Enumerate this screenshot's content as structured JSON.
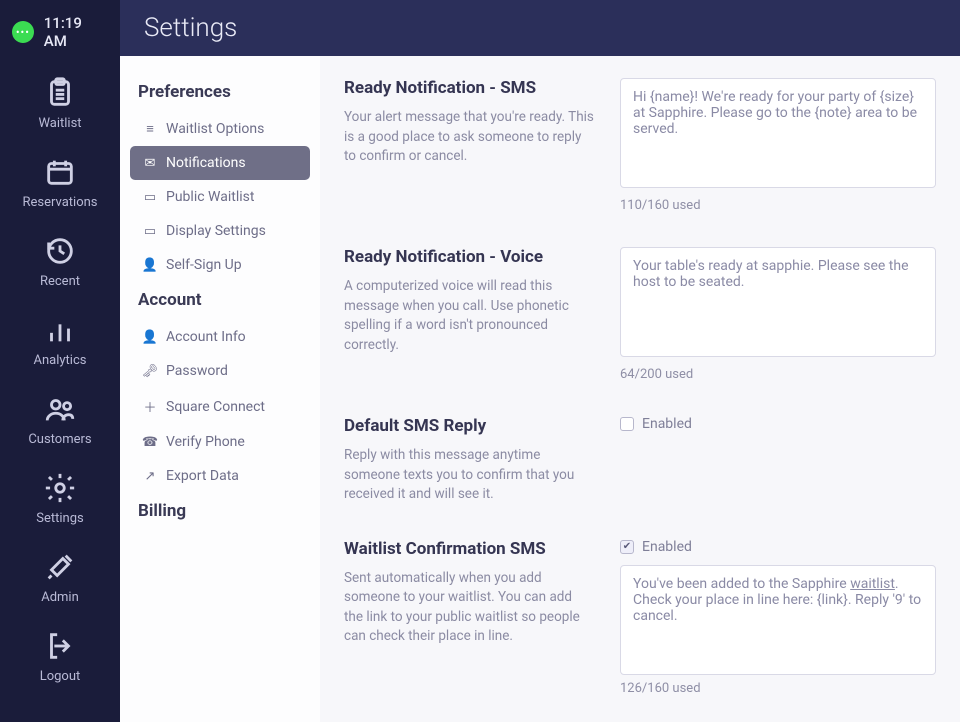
{
  "header": {
    "title": "Settings",
    "clock": "11:19 AM"
  },
  "nav": {
    "items": [
      {
        "label": "Waitlist"
      },
      {
        "label": "Reservations"
      },
      {
        "label": "Recent"
      },
      {
        "label": "Analytics"
      },
      {
        "label": "Customers"
      },
      {
        "label": "Settings"
      },
      {
        "label": "Admin"
      },
      {
        "label": "Logout"
      }
    ]
  },
  "settingsNav": {
    "groups": [
      {
        "title": "Preferences",
        "items": [
          {
            "label": "Waitlist Options",
            "icon": "≡"
          },
          {
            "label": "Notifications",
            "icon": "✉",
            "active": true
          },
          {
            "label": "Public Waitlist",
            "icon": "▭"
          },
          {
            "label": "Display Settings",
            "icon": "▭"
          },
          {
            "label": "Self-Sign Up",
            "icon": "👤"
          }
        ]
      },
      {
        "title": "Account",
        "items": [
          {
            "label": "Account Info",
            "icon": "👤"
          },
          {
            "label": "Password",
            "icon": "🗝"
          },
          {
            "label": "Square Connect",
            "icon": "＋"
          },
          {
            "label": "Verify Phone",
            "icon": "☎"
          },
          {
            "label": "Export Data",
            "icon": "↗"
          }
        ]
      },
      {
        "title": "Billing",
        "items": []
      }
    ]
  },
  "sections": {
    "readySms": {
      "title": "Ready Notification - SMS",
      "desc": "Your alert message that you're ready. This is a good place to ask someone to reply to confirm or cancel.",
      "value": "Hi {name}! We're ready for your party of {size} at Sapphire. Please go to the {note} area to be served.",
      "counter": "110/160 used"
    },
    "readyVoice": {
      "title": "Ready Notification - Voice",
      "desc": "A computerized voice will read this message when you call. Use phonetic spelling if a word isn't pronounced correctly.",
      "value": "Your table's ready at sapphie. Please see the host to be seated.",
      "counter": "64/200 used"
    },
    "defaultReply": {
      "title": "Default SMS Reply",
      "desc": "Reply with this message anytime someone texts you to confirm that you received it and will see it.",
      "enableLabel": "Enabled",
      "enabled": false
    },
    "waitlistConfirm": {
      "title": "Waitlist Confirmation SMS",
      "desc": "Sent automatically when you add someone to your waitlist. You can add the link to your public waitlist so people can check their place in line.",
      "enableLabel": "Enabled",
      "enabled": true,
      "value_pre": "You've been added to the Sapphire ",
      "value_link": "waitlist",
      "value_post": ". Check your place in line here: {link}. Reply '9' to cancel.",
      "counter": "126/160 used"
    }
  }
}
